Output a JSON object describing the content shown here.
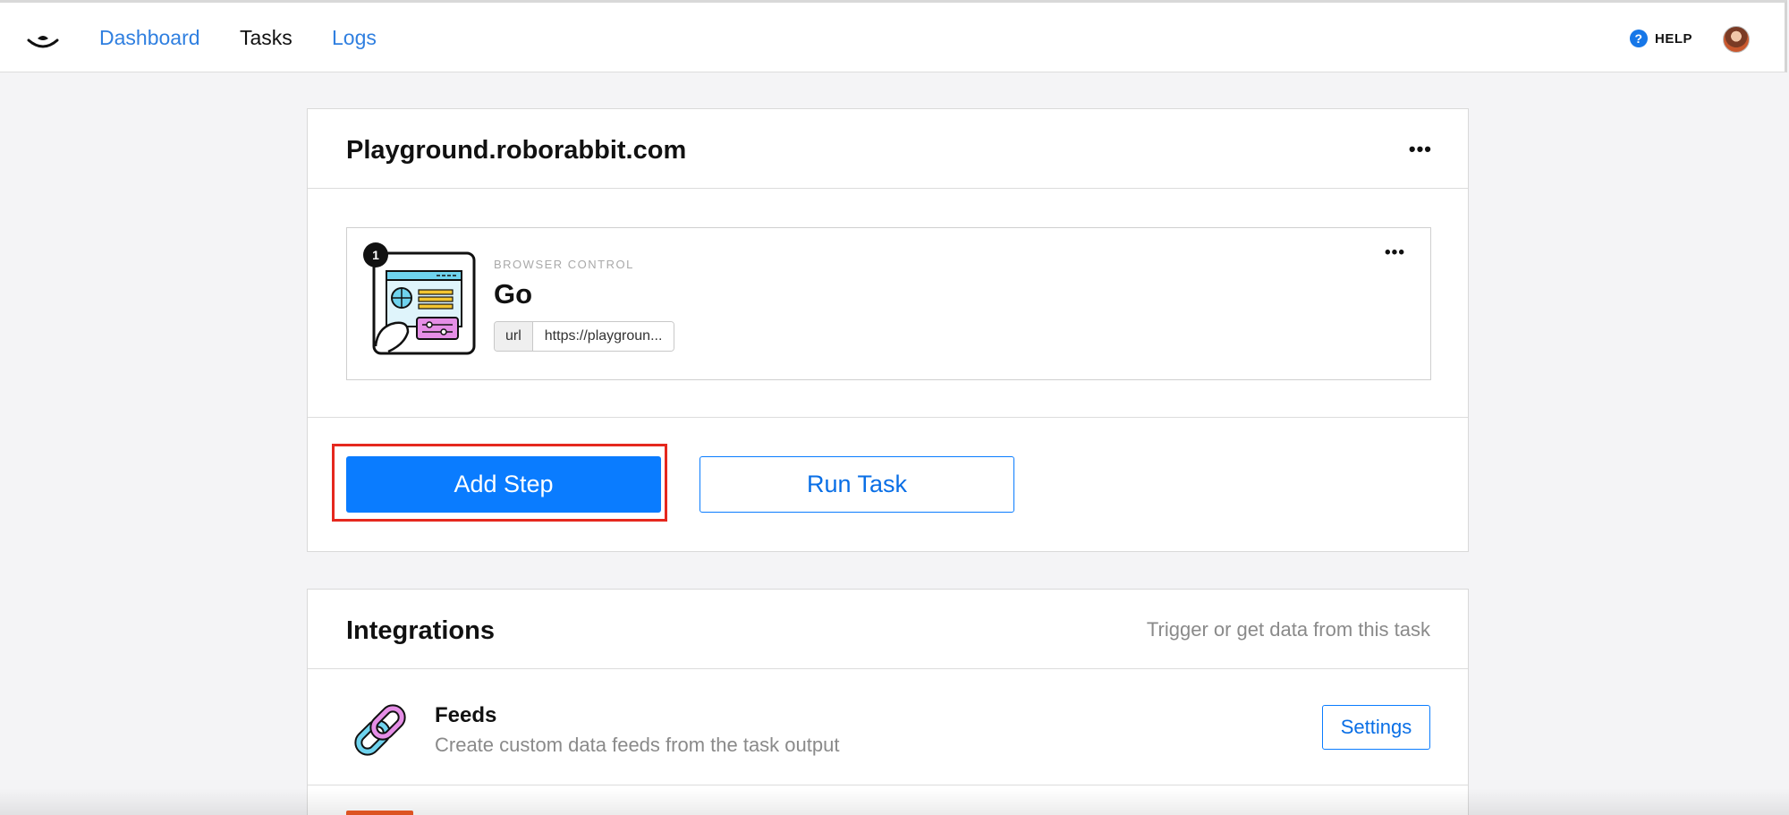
{
  "nav": {
    "links": [
      "Dashboard",
      "Tasks",
      "Logs"
    ],
    "help_label": "HELP",
    "help_glyph": "?"
  },
  "task": {
    "title": "Playground.roborabbit.com",
    "menu_glyph": "•••",
    "step": {
      "number": "1",
      "category": "BROWSER CONTROL",
      "name": "Go",
      "param_key": "url",
      "param_value": "https://playgroun...",
      "menu_glyph": "•••",
      "icon": "browser-window-illustration-icon"
    },
    "add_step_label": "Add Step",
    "run_task_label": "Run Task"
  },
  "integrations": {
    "title": "Integrations",
    "subtitle": "Trigger or get data from this task",
    "items": [
      {
        "title": "Feeds",
        "description": "Create custom data feeds from the task output",
        "button": "Settings",
        "icon": "chain-link-icon"
      }
    ]
  },
  "colors": {
    "primary": "#0a7cff",
    "highlight": "#e5281e",
    "link": "#2f7fe0"
  }
}
